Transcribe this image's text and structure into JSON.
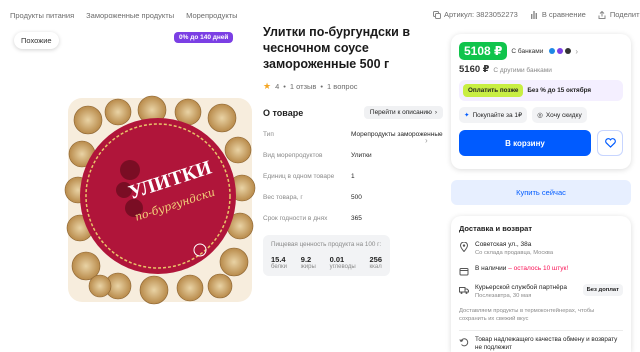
{
  "breadcrumb": [
    "Продукты питания",
    "Замороженные продукты",
    "Морепродукты"
  ],
  "top_actions": {
    "article": "Артикул: 3823052273",
    "compare": "В сравнение",
    "share": "Поделиться"
  },
  "gallery": {
    "similar_label": "Похожие",
    "promo_label": "0% до 140 дней",
    "package_brand": "УЛИТКИ",
    "package_subtitle": "по-бургундски"
  },
  "product": {
    "title": "Улитки по-бургундски в чесночном соусе замороженные 500 г",
    "rating": "4",
    "reviews": "1 отзыв",
    "questions": "1 вопрос"
  },
  "about": {
    "title": "О товаре",
    "goto_label": "Перейти к описанию",
    "specs": [
      {
        "key": "Тип",
        "value": "Морепродукты замороженные"
      },
      {
        "key": "Вид морепродуктов",
        "value": "Улитки"
      },
      {
        "key": "Единиц в одном товаре",
        "value": "1"
      },
      {
        "key": "Вес товара, г",
        "value": "500"
      },
      {
        "key": "Срок годности в днях",
        "value": "365"
      }
    ],
    "nutrition": {
      "title": "Пищевая ценность продукта на 100 г:",
      "items": [
        {
          "value": "15.4",
          "label": "белки"
        },
        {
          "value": "9.2",
          "label": "жиры"
        },
        {
          "value": "0.01",
          "label": "углеводы"
        },
        {
          "value": "256",
          "label": "ккал"
        }
      ]
    }
  },
  "pricing": {
    "price_bank": "5108 ₽",
    "price_bank_label": "С банками",
    "price_other": "5160 ₽",
    "price_other_label": "С другими банками",
    "pay_later_button": "Оплатить позже",
    "pay_later_text": "Без % до 15 октября",
    "buy_for_label": "Покупайте за 1₽",
    "want_discount_label": "Хочу скидку",
    "cart_label": "В корзину",
    "buy_now_label": "Купить сейчас",
    "colors": {
      "price": "#10c44c",
      "cart": "#005bff",
      "pay_later": "#c8ee44"
    }
  },
  "delivery": {
    "title": "Доставка и возврат",
    "address_main": "Советская ул., 38а",
    "address_sub": "Со склада продавца, Москва",
    "stock_prefix": "В наличии",
    "stock_warning": "– осталось 10 штук!",
    "courier_main": "Курьерской службой партнёра",
    "courier_sub": "Послезавтра, 30 мая",
    "free_label": "Без доплат",
    "note": "Доставляем продукты в термоконтейнерах, чтобы сохранить их свежий вкус",
    "quality": "Товар надлежащего качества обмену и возврату не подлежит"
  }
}
